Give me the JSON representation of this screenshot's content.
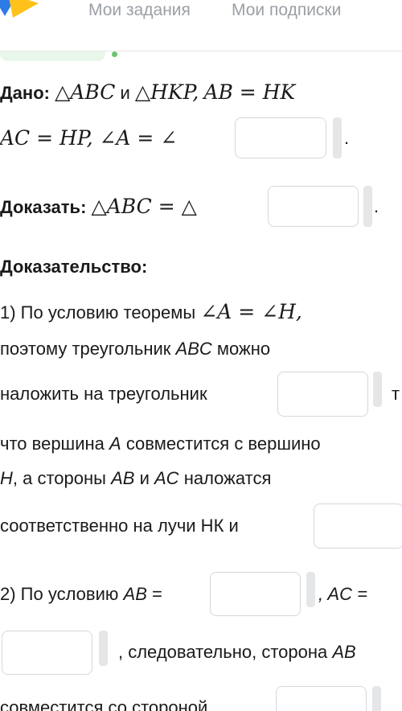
{
  "nav": {
    "tab_tasks": "Мои задания",
    "tab_subscriptions": "Мои подписки",
    "logo_icon": "brand-logo-icon"
  },
  "given": {
    "label": "Дано:",
    "line1": {
      "tri1": "△ABC",
      "conj": "и",
      "tri2": "△HKP,",
      "eq": "AB = HK"
    },
    "line2": {
      "eq": "AC = HP, ∠A = ∠",
      "dot": "."
    }
  },
  "prove": {
    "label": "Доказать:",
    "eq": "△ABC = △",
    "dot": "."
  },
  "proof": {
    "heading": "Доказательство:",
    "s1a": "1) По условию теоремы",
    "s1a_math": "∠A = ∠H,",
    "s1b_pre": "поэтому треугольник",
    "s1b_abc": "ABC",
    "s1b_post": "можно",
    "s1c": "наложить на треугольник",
    "s1c_after": "т",
    "s1d_pre": "что вершина",
    "s1d_a": "A",
    "s1d_post": "совместится с вершино",
    "s1e_h": "H",
    "s1e_mid": ", а стороны",
    "s1e_ab": "AB",
    "s1e_and": "и",
    "s1e_ac": "AC",
    "s1e_post": "наложатся",
    "s1f": "соответственно на лучи НК и",
    "s2a_pre": "2) По условию",
    "s2a_ab": "AB",
    "s2a_eq": "=",
    "s2a_ac": ", AC =",
    "s2b": ", следовательно, сторона",
    "s2b_ab": "AB",
    "s2c": "совместится со стороной"
  }
}
